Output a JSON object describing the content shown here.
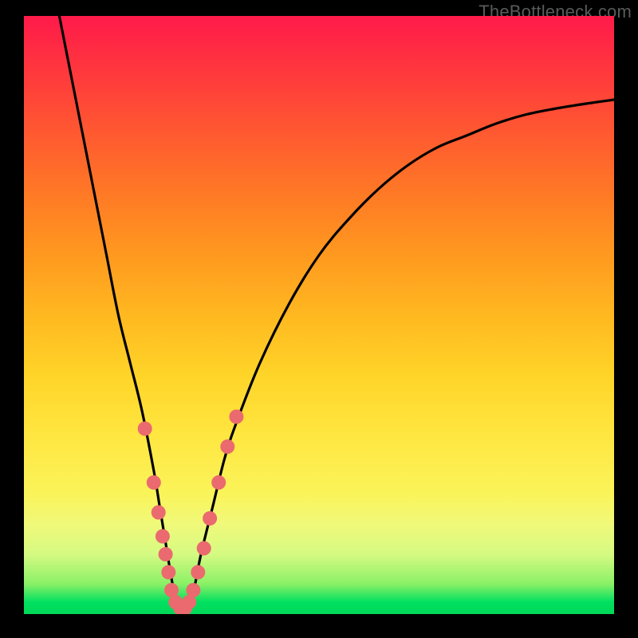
{
  "watermark": "TheBottleneck.com",
  "colors": {
    "curve": "#000000",
    "dot_fill": "#ea6a6f",
    "dot_stroke": "#d94f56",
    "background_border": "#000000"
  },
  "chart_data": {
    "type": "line",
    "title": "",
    "xlabel": "",
    "ylabel": "",
    "xlim": [
      0,
      100
    ],
    "ylim": [
      0,
      100
    ],
    "note": "Axes unlabeled; x is a normalized component metric increasing rightward; y is bottleneck percentage (0 at bottom = no_bottleneck/green, 100 top = severe/red). Values read off vertical position against the color gradient.",
    "series": [
      {
        "name": "bottleneck_curve",
        "x": [
          6,
          8,
          10,
          12,
          14,
          16,
          18,
          20,
          22,
          23,
          24,
          25,
          26,
          27,
          28,
          29,
          30,
          32,
          34,
          36,
          40,
          45,
          50,
          55,
          60,
          65,
          70,
          75,
          80,
          85,
          90,
          95,
          100
        ],
        "y": [
          100,
          90,
          80,
          70,
          60,
          50,
          42,
          34,
          24,
          18,
          12,
          6,
          1,
          0,
          1,
          5,
          10,
          18,
          26,
          32,
          42,
          52,
          60,
          66,
          71,
          75,
          78,
          80,
          82,
          83.5,
          84.5,
          85.3,
          86
        ]
      }
    ],
    "markers": {
      "name": "sampled_points",
      "description": "Highlighted data points clustered near the valley (optimal pairing region)",
      "points": [
        {
          "x": 20.5,
          "y": 31
        },
        {
          "x": 22.0,
          "y": 22
        },
        {
          "x": 22.8,
          "y": 17
        },
        {
          "x": 23.5,
          "y": 13
        },
        {
          "x": 24.0,
          "y": 10
        },
        {
          "x": 24.5,
          "y": 7
        },
        {
          "x": 25.0,
          "y": 4
        },
        {
          "x": 25.7,
          "y": 2
        },
        {
          "x": 26.5,
          "y": 1
        },
        {
          "x": 27.3,
          "y": 1
        },
        {
          "x": 28.0,
          "y": 2
        },
        {
          "x": 28.7,
          "y": 4
        },
        {
          "x": 29.5,
          "y": 7
        },
        {
          "x": 30.5,
          "y": 11
        },
        {
          "x": 31.5,
          "y": 16
        },
        {
          "x": 33.0,
          "y": 22
        },
        {
          "x": 34.5,
          "y": 28
        },
        {
          "x": 36.0,
          "y": 33
        }
      ]
    }
  }
}
